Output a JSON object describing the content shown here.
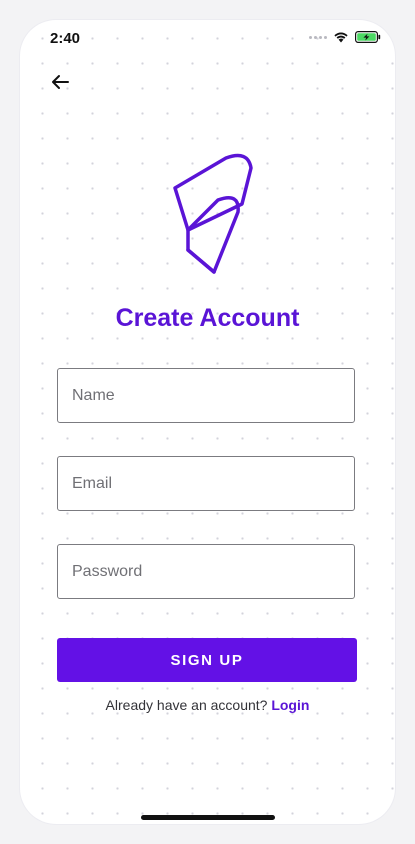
{
  "status_bar": {
    "time": "2:40",
    "icons": [
      "signal-dots-icon",
      "wifi-icon",
      "battery-charging-icon"
    ],
    "battery_color": "#4cd964"
  },
  "header": {
    "back_icon": "arrow-left-icon"
  },
  "logo": {
    "icon": "brand-logo-icon",
    "color": "#5a14d6"
  },
  "title": "Create Account",
  "form": {
    "name_placeholder": "Name",
    "email_placeholder": "Email",
    "password_placeholder": "Password",
    "submit_label": "SIGN UP"
  },
  "footer": {
    "prompt": "Already have an account?",
    "login_label": "Login"
  },
  "colors": {
    "accent": "#5a14d6",
    "button": "#6311e6"
  }
}
